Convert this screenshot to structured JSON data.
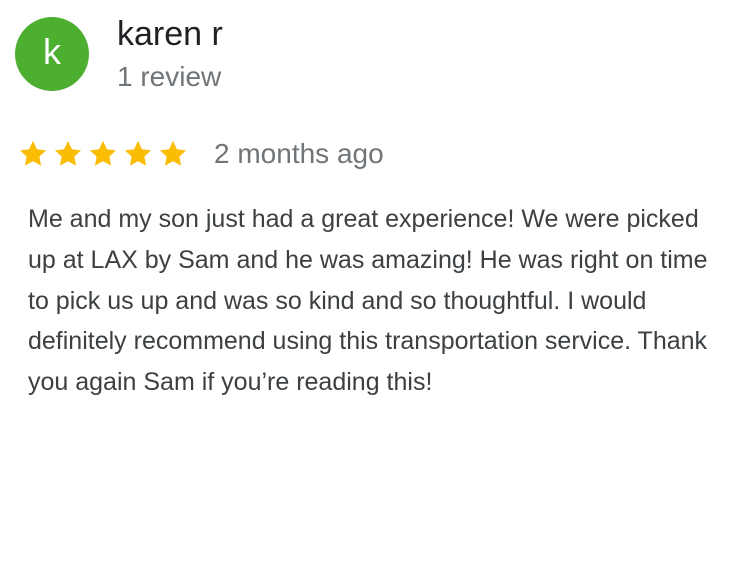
{
  "reviewer": {
    "initial": "k",
    "name": "karen r",
    "review_count": "1 review",
    "avatar_color": "#4caf2f"
  },
  "rating": {
    "stars": 5,
    "max_stars": 5,
    "star_icon": "star-icon",
    "star_color": "#fbbc04",
    "time": "2 months ago"
  },
  "review": {
    "text": "Me and my son just had a great experience! We were picked up at LAX by Sam and he was amazing! He was right on time to pick us up and was so kind and so thoughtful. I would definitely recommend using this transportation service. Thank you again Sam if you’re reading this!"
  }
}
